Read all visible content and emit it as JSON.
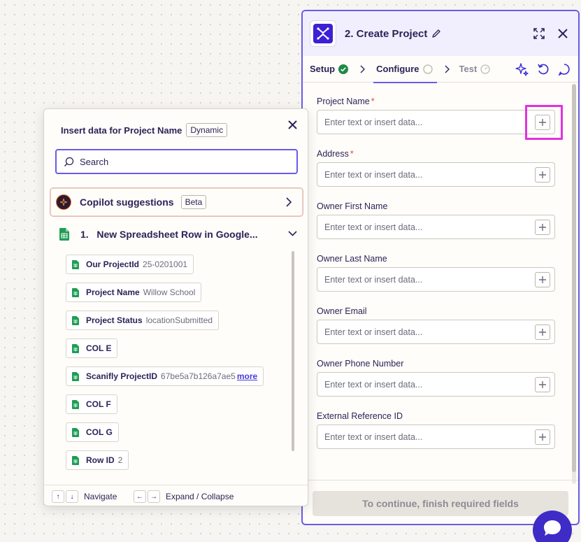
{
  "step": {
    "title": "2. Create Project",
    "tabs": [
      {
        "label": "Setup",
        "status": "complete"
      },
      {
        "label": "Configure",
        "status": "in-progress"
      },
      {
        "label": "Test",
        "status": "pending"
      }
    ],
    "fields": [
      {
        "label": "Project Name",
        "required": "*",
        "placeholder": "Enter text or insert data..."
      },
      {
        "label": "Address",
        "required": "*",
        "placeholder": "Enter text or insert data..."
      },
      {
        "label": "Owner First Name",
        "required": "",
        "placeholder": "Enter text or insert data..."
      },
      {
        "label": "Owner Last Name",
        "required": "",
        "placeholder": "Enter text or insert data..."
      },
      {
        "label": "Owner Email",
        "required": "",
        "placeholder": "Enter text or insert data..."
      },
      {
        "label": "Owner Phone Number",
        "required": "",
        "placeholder": "Enter text or insert data..."
      },
      {
        "label": "External Reference ID",
        "required": "",
        "placeholder": "Enter text or insert data..."
      }
    ],
    "continue_label": "To continue, finish required fields"
  },
  "insert_panel": {
    "title": "Insert data for Project Name",
    "mode_badge": "Dynamic",
    "search_placeholder": "Search",
    "copilot": {
      "label": "Copilot suggestions",
      "badge": "Beta"
    },
    "group": {
      "number": "1.",
      "title": "New Spreadsheet Row in Google..."
    },
    "items": [
      {
        "key": "Our ProjectId",
        "value": "25-0201001"
      },
      {
        "key": "Project Name",
        "value": "Willow School"
      },
      {
        "key": "Project Status",
        "value": "locationSubmitted"
      },
      {
        "key": "COL E",
        "value": ""
      },
      {
        "key": "Scanifly ProjectID",
        "value": "67be5a7b126a7ae5",
        "more": "more"
      },
      {
        "key": "COL F",
        "value": ""
      },
      {
        "key": "COL G",
        "value": ""
      },
      {
        "key": "Row ID",
        "value": "2"
      }
    ],
    "footer": {
      "navigate_keys": [
        "↑",
        "↓"
      ],
      "navigate_label": "Navigate",
      "expand_keys": [
        "←",
        "→"
      ],
      "expand_label": "Expand / Collapse"
    }
  },
  "colors": {
    "accent": "#695be8",
    "highlight": "#e032e0",
    "required": "#e0492b",
    "sheets_green": "#1f9d55",
    "setup_check": "#1f8a47"
  }
}
